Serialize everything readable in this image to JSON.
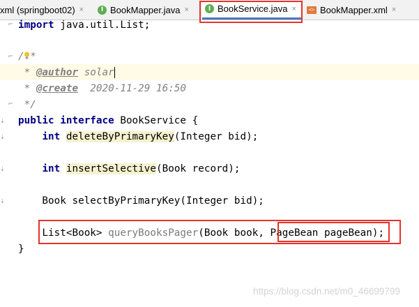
{
  "tabs": [
    {
      "label": "xml (springboot02)",
      "icon": "none"
    },
    {
      "label": "BookMapper.java",
      "icon": "interface-icon"
    },
    {
      "label": "BookService.java",
      "icon": "interface-icon",
      "active": true
    },
    {
      "label": "BookMapper.xml",
      "icon": "xml-file-icon"
    }
  ],
  "tab_close_glyph": "×",
  "tab_icon_letter": "I",
  "xml_icon_text": "<>",
  "code": {
    "import_kw": "import",
    "import_rest": " java.util.List;",
    "doc_open": "/**",
    "author_prefix": " * ",
    "author_tag": "@author",
    "author_value": " solar",
    "create_prefix": " * ",
    "create_tag": "@create",
    "create_value": "  2020-11-29 16:50",
    "doc_close": " */",
    "public_kw": "public",
    "interface_kw": "interface",
    "interface_name": " BookService {",
    "m1_indent": "    ",
    "m1_type": "int",
    "m1_name": "deleteByPrimaryKey",
    "m1_params": "(Integer bid);",
    "m2_indent": "    ",
    "m2_type": "int",
    "m2_name": "insertSelective",
    "m2_params": "(Book record);",
    "m3_text": "    Book selectByPrimaryKey(Integer bid);",
    "m4_indent": "    ",
    "m4_return": "List<Book> ",
    "m4_name": "queryBooksPager",
    "m4_params_a": "(Book book, ",
    "m4_params_b": "PageBean pageBean",
    "m4_params_c": ");",
    "close_brace": "}"
  },
  "watermark": "https://blog.csdn.net/m0_46699799",
  "colors": {
    "keyword": "#000080",
    "comment": "#808080",
    "highlight_box": "#e5332a",
    "active_tab_underline": "#4a78c2"
  }
}
